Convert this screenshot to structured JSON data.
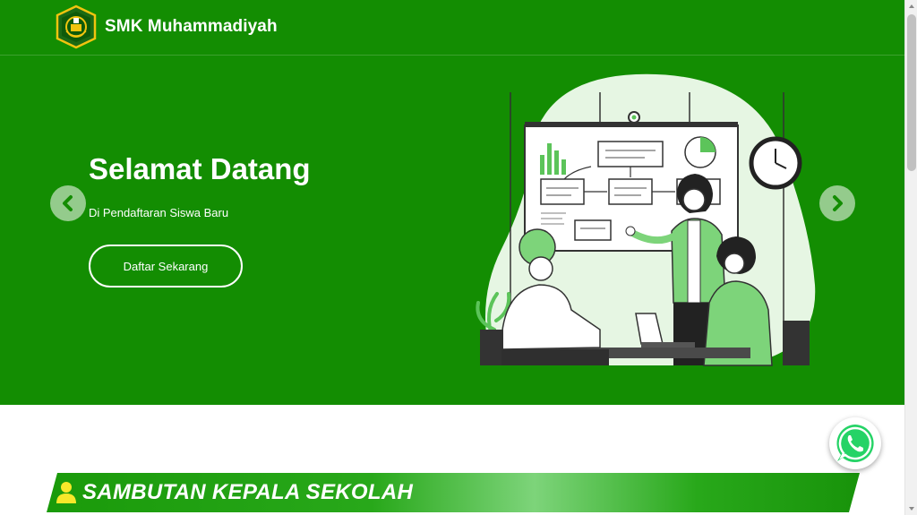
{
  "header": {
    "brand_name": "SMK Muhammadiyah",
    "logo_icon": "school-emblem-icon"
  },
  "hero": {
    "title": "Selamat Datang",
    "subtitle": "Di Pendaftaran Siswa Baru",
    "cta_label": "Daftar Sekarang",
    "prev_icon": "chevron-left-icon",
    "next_icon": "chevron-right-icon",
    "background_color": "#138d02",
    "illustration": "team-presentation-illustration"
  },
  "section": {
    "heading": "SAMBUTAN KEPALA SEKOLAH",
    "icon": "user-icon"
  },
  "floating": {
    "whatsapp_icon": "whatsapp-icon"
  },
  "colors": {
    "primary": "#138d02",
    "accent_light": "#7dd47a",
    "whatsapp": "#25d366"
  }
}
